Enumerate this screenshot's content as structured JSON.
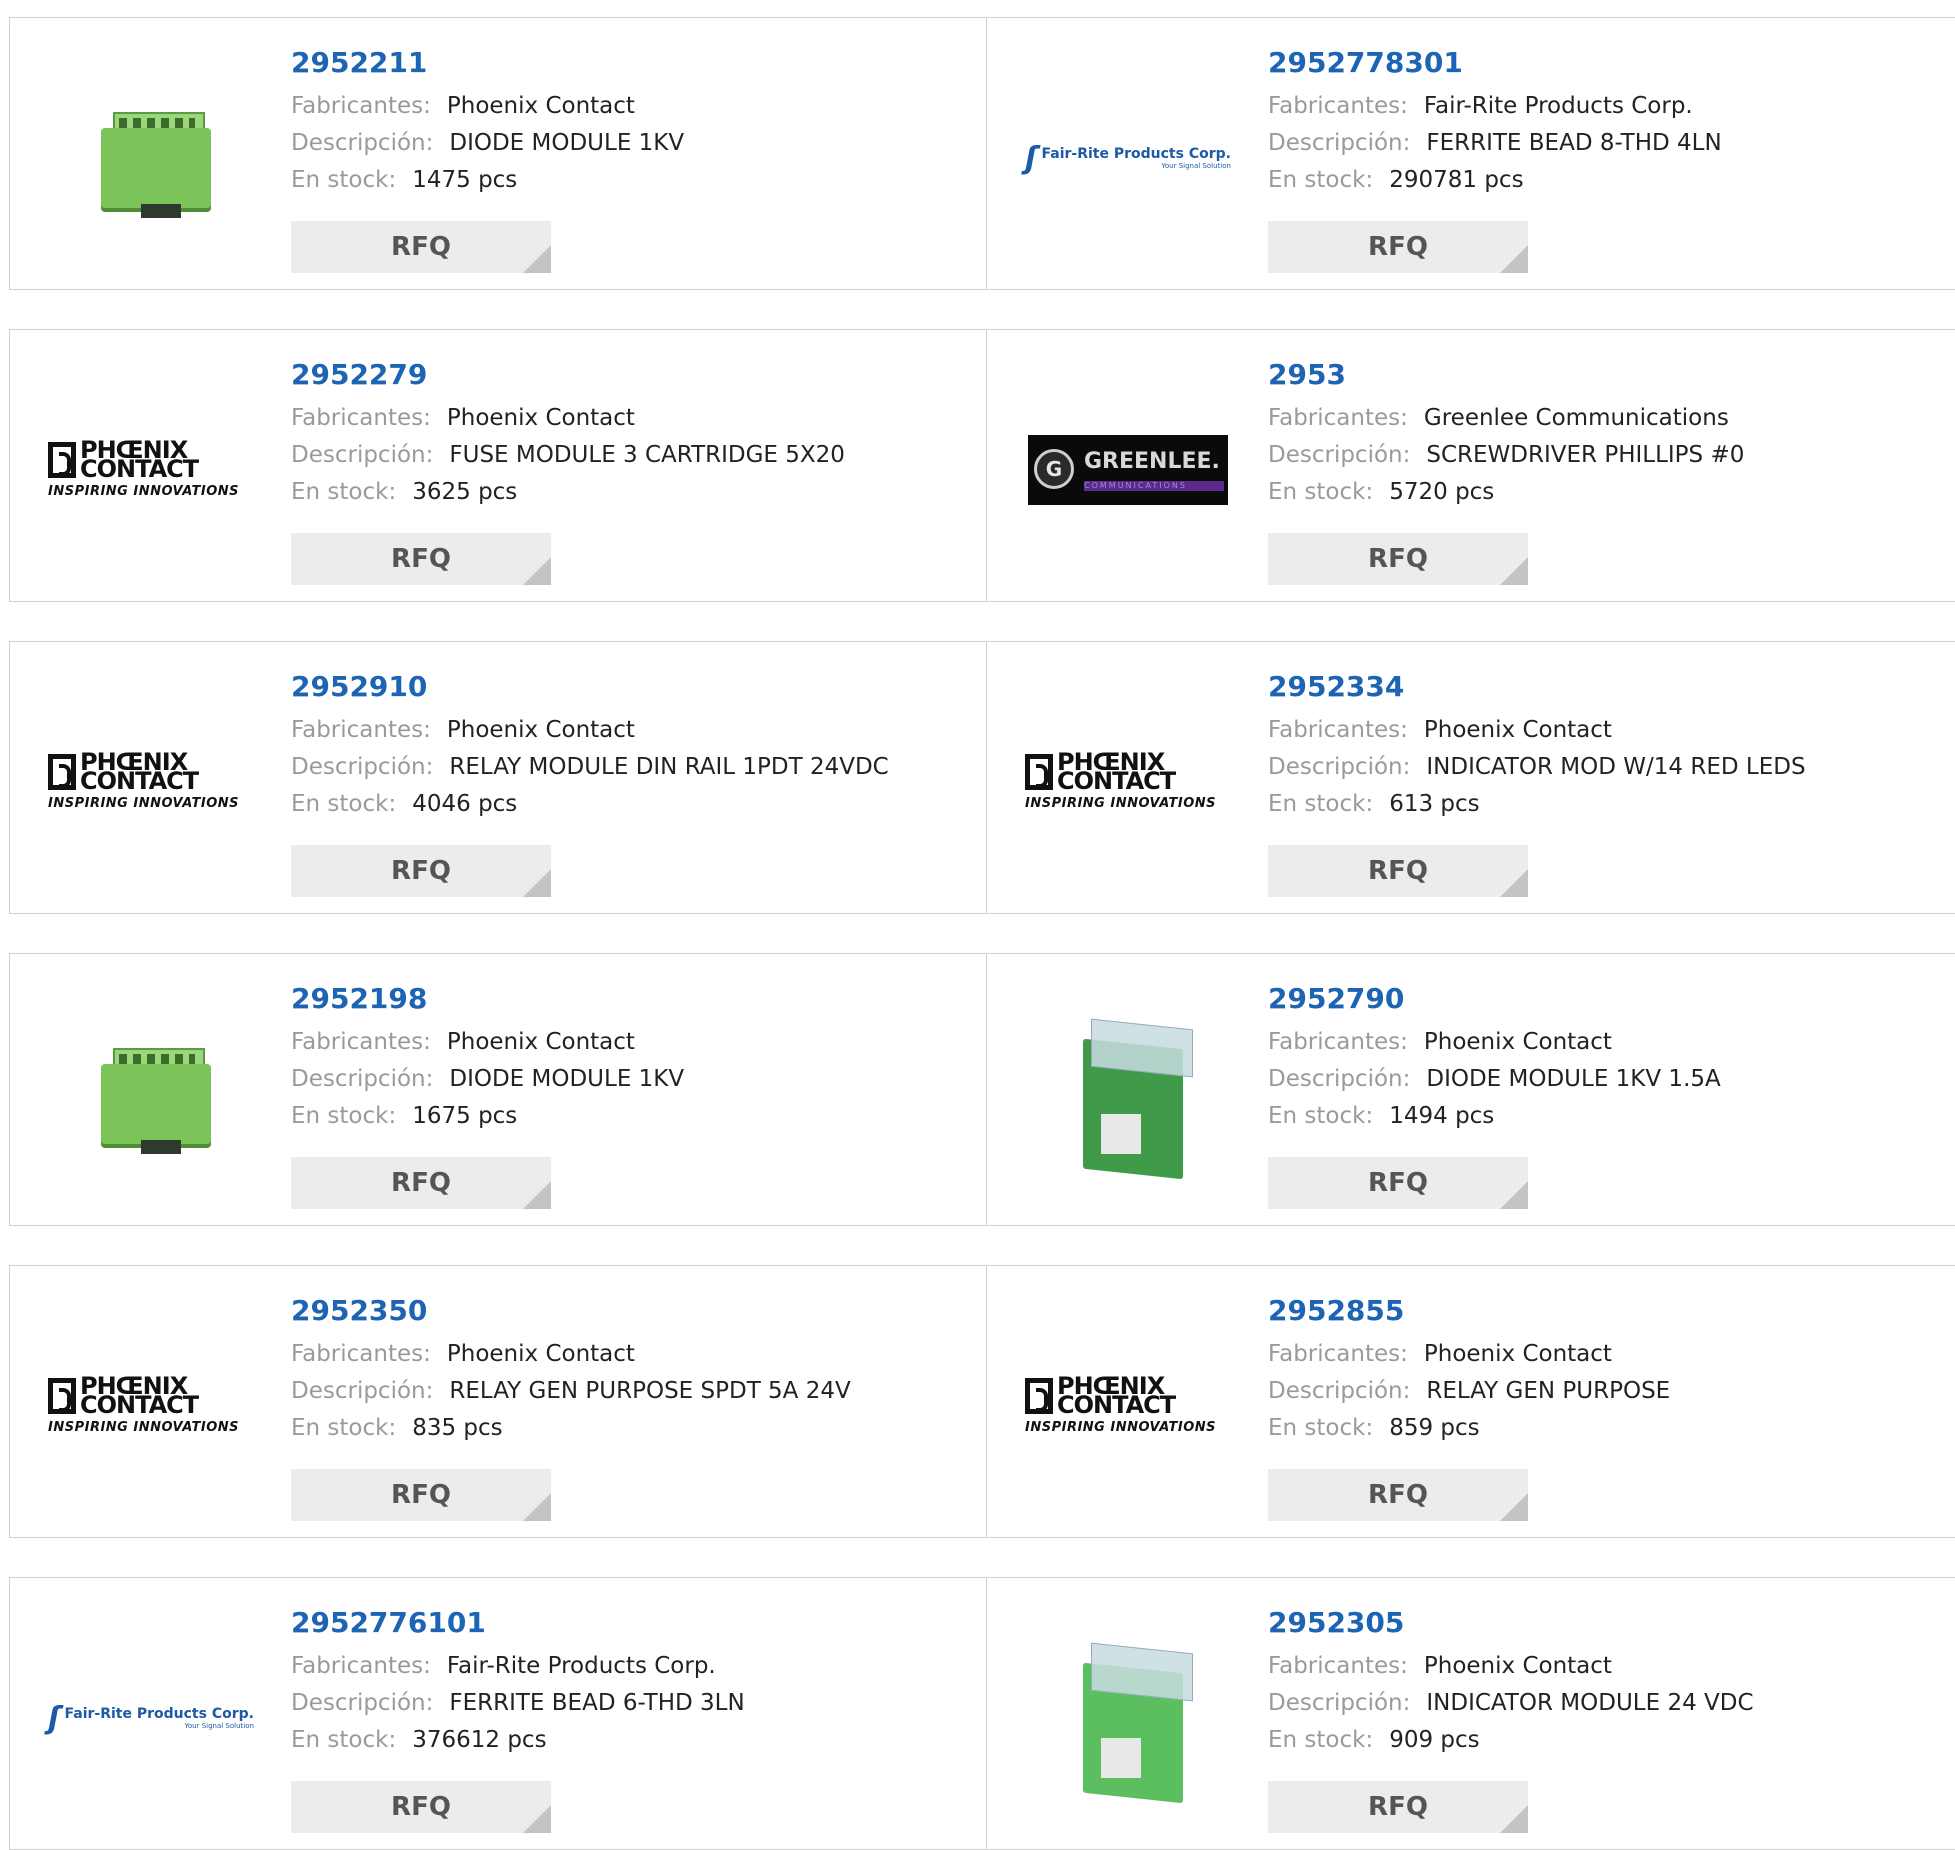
{
  "labels": {
    "manufacturer": "Fabricantes:",
    "description": "Descripción:",
    "stock": "En stock:",
    "rfq": "RFQ"
  },
  "products": [
    {
      "pn": "2952211",
      "manufacturer": "Phoenix Contact",
      "description": "DIODE MODULE 1KV",
      "stock": "1475 pcs",
      "image": "green-module"
    },
    {
      "pn": "2952778301",
      "manufacturer": "Fair-Rite Products Corp.",
      "description": "FERRITE BEAD 8-THD 4LN",
      "stock": "290781 pcs",
      "image": "fair-rite-logo"
    },
    {
      "pn": "2952279",
      "manufacturer": "Phoenix Contact",
      "description": "FUSE MODULE 3 CARTRIDGE 5X20",
      "stock": "3625 pcs",
      "image": "phoenix-contact-logo"
    },
    {
      "pn": "2953",
      "manufacturer": "Greenlee Communications",
      "description": "SCREWDRIVER PHILLIPS #0",
      "stock": "5720 pcs",
      "image": "greenlee-logo"
    },
    {
      "pn": "2952910",
      "manufacturer": "Phoenix Contact",
      "description": "RELAY MODULE DIN RAIL 1PDT 24VDC",
      "stock": "4046 pcs",
      "image": "phoenix-contact-logo"
    },
    {
      "pn": "2952334",
      "manufacturer": "Phoenix Contact",
      "description": "INDICATOR MOD W/14 RED LEDS",
      "stock": "613 pcs",
      "image": "phoenix-contact-logo"
    },
    {
      "pn": "2952198",
      "manufacturer": "Phoenix Contact",
      "description": "DIODE MODULE 1KV",
      "stock": "1675 pcs",
      "image": "green-module"
    },
    {
      "pn": "2952790",
      "manufacturer": "Phoenix Contact",
      "description": "DIODE MODULE 1KV 1.5A",
      "stock": "1494 pcs",
      "image": "tall-module"
    },
    {
      "pn": "2952350",
      "manufacturer": "Phoenix Contact",
      "description": "RELAY GEN PURPOSE SPDT 5A 24V",
      "stock": "835 pcs",
      "image": "phoenix-contact-logo"
    },
    {
      "pn": "2952855",
      "manufacturer": "Phoenix Contact",
      "description": "RELAY GEN PURPOSE",
      "stock": "859 pcs",
      "image": "phoenix-contact-logo"
    },
    {
      "pn": "2952776101",
      "manufacturer": "Fair-Rite Products Corp.",
      "description": "FERRITE BEAD 6-THD 3LN",
      "stock": "376612 pcs",
      "image": "fair-rite-logo"
    },
    {
      "pn": "2952305",
      "manufacturer": "Phoenix Contact",
      "description": "INDICATOR MODULE 24 VDC",
      "stock": "909 pcs",
      "image": "tall-module-2"
    }
  ],
  "logos": {
    "phoenix_word1": "PHŒNIX",
    "phoenix_word2": "CONTACT",
    "phoenix_tag": "INSPIRING INNOVATIONS",
    "fairrite_name": "Fair-Rite Products Corp.",
    "fairrite_sub": "Your Signal Solution",
    "greenlee_name": "GREENLEE.",
    "greenlee_sub": "COMMUNICATIONS",
    "greenlee_mark": "G"
  },
  "colors": {
    "part_number": "#1e64b4",
    "label": "#9a9a9a",
    "value": "#222222",
    "rfq_bg": "#ececec"
  }
}
